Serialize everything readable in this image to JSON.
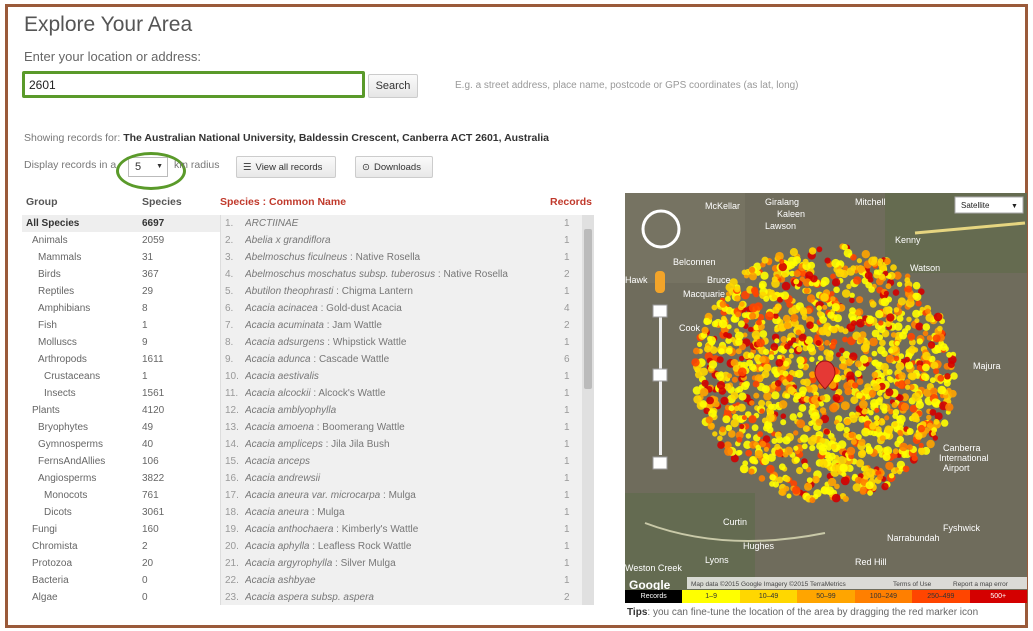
{
  "page": {
    "title": "Explore Your Area",
    "subtitle": "Enter your location or address:",
    "search_value": "2601",
    "search_button": "Search",
    "hint": "E.g. a street address, place name, postcode or GPS coordinates (as lat, long)",
    "showing_prefix": "Showing records for:",
    "showing_location": "The Australian National University, Baldessin Crescent, Canberra ACT 2601, Australia",
    "display_prefix": "Display records in a",
    "radius": "5",
    "radius_suffix": "km radius",
    "view_all": "View all records",
    "downloads": "Downloads"
  },
  "table": {
    "group_header": "Group",
    "species_header": "Species",
    "list_header": "Species : Common Name",
    "records_header": "Records"
  },
  "groups": [
    {
      "name": "All Species",
      "count": "6697",
      "indent": 0,
      "active": true
    },
    {
      "name": "Animals",
      "count": "2059",
      "indent": 1
    },
    {
      "name": "Mammals",
      "count": "31",
      "indent": 2
    },
    {
      "name": "Birds",
      "count": "367",
      "indent": 2
    },
    {
      "name": "Reptiles",
      "count": "29",
      "indent": 2
    },
    {
      "name": "Amphibians",
      "count": "8",
      "indent": 2
    },
    {
      "name": "Fish",
      "count": "1",
      "indent": 2
    },
    {
      "name": "Molluscs",
      "count": "9",
      "indent": 2
    },
    {
      "name": "Arthropods",
      "count": "1611",
      "indent": 2
    },
    {
      "name": "Crustaceans",
      "count": "1",
      "indent": 3
    },
    {
      "name": "Insects",
      "count": "1561",
      "indent": 3
    },
    {
      "name": "Plants",
      "count": "4120",
      "indent": 1
    },
    {
      "name": "Bryophytes",
      "count": "49",
      "indent": 2
    },
    {
      "name": "Gymnosperms",
      "count": "40",
      "indent": 2
    },
    {
      "name": "FernsAndAllies",
      "count": "106",
      "indent": 2
    },
    {
      "name": "Angiosperms",
      "count": "3822",
      "indent": 2
    },
    {
      "name": "Monocots",
      "count": "761",
      "indent": 3
    },
    {
      "name": "Dicots",
      "count": "3061",
      "indent": 3
    },
    {
      "name": "Fungi",
      "count": "160",
      "indent": 1
    },
    {
      "name": "Chromista",
      "count": "2",
      "indent": 1
    },
    {
      "name": "Protozoa",
      "count": "20",
      "indent": 1
    },
    {
      "name": "Bacteria",
      "count": "0",
      "indent": 1
    },
    {
      "name": "Algae",
      "count": "0",
      "indent": 1
    }
  ],
  "species": [
    {
      "n": "1.",
      "sci": "ARCTIINAE",
      "common": "",
      "rec": "1"
    },
    {
      "n": "2.",
      "sci": "Abelia x grandiflora",
      "common": "",
      "rec": "1"
    },
    {
      "n": "3.",
      "sci": "Abelmoschus ficulneus",
      "common": "Native Rosella",
      "rec": "1"
    },
    {
      "n": "4.",
      "sci": "Abelmoschus moschatus subsp. tuberosus",
      "common": "Native Rosella",
      "rec": "2"
    },
    {
      "n": "5.",
      "sci": "Abutilon theophrasti",
      "common": "Chigma Lantern",
      "rec": "1"
    },
    {
      "n": "6.",
      "sci": "Acacia acinacea",
      "common": "Gold-dust Acacia",
      "rec": "4"
    },
    {
      "n": "7.",
      "sci": "Acacia acuminata",
      "common": "Jam Wattle",
      "rec": "2"
    },
    {
      "n": "8.",
      "sci": "Acacia adsurgens",
      "common": "Whipstick Wattle",
      "rec": "1"
    },
    {
      "n": "9.",
      "sci": "Acacia adunca",
      "common": "Cascade Wattle",
      "rec": "6"
    },
    {
      "n": "10.",
      "sci": "Acacia aestivalis",
      "common": "",
      "rec": "1"
    },
    {
      "n": "11.",
      "sci": "Acacia alcockii",
      "common": "Alcock's Wattle",
      "rec": "1"
    },
    {
      "n": "12.",
      "sci": "Acacia amblyophylla",
      "common": "",
      "rec": "1"
    },
    {
      "n": "13.",
      "sci": "Acacia amoena",
      "common": "Boomerang Wattle",
      "rec": "1"
    },
    {
      "n": "14.",
      "sci": "Acacia ampliceps",
      "common": "Jila Jila Bush",
      "rec": "1"
    },
    {
      "n": "15.",
      "sci": "Acacia anceps",
      "common": "",
      "rec": "1"
    },
    {
      "n": "16.",
      "sci": "Acacia andrewsii",
      "common": "",
      "rec": "1"
    },
    {
      "n": "17.",
      "sci": "Acacia aneura var. microcarpa",
      "common": "Mulga",
      "rec": "1"
    },
    {
      "n": "18.",
      "sci": "Acacia aneura",
      "common": "Mulga",
      "rec": "1"
    },
    {
      "n": "19.",
      "sci": "Acacia anthochaera",
      "common": "Kimberly's Wattle",
      "rec": "1"
    },
    {
      "n": "20.",
      "sci": "Acacia aphylla",
      "common": "Leafless Rock Wattle",
      "rec": "1"
    },
    {
      "n": "21.",
      "sci": "Acacia argyrophylla",
      "common": "Silver Mulga",
      "rec": "1"
    },
    {
      "n": "22.",
      "sci": "Acacia ashbyae",
      "common": "",
      "rec": "1"
    },
    {
      "n": "23.",
      "sci": "Acacia aspera subsp. aspera",
      "common": "",
      "rec": "2"
    }
  ],
  "map": {
    "type_select": "Satellite",
    "places": [
      "McKellar",
      "Giralang",
      "Kaleen",
      "Lawson",
      "Mitchell",
      "Kenny",
      "Belconnen",
      "Bruce",
      "Watson",
      "Macquarie",
      "Cook",
      "Hawk",
      "Majura",
      "Canberra International Airport",
      "Curtin",
      "Hughes",
      "Narrabundah",
      "Red Hill",
      "Lyons",
      "Weston Creek",
      "Fyshwick"
    ],
    "attribution": "Map data ©2015 Google Imagery ©2015 TerraMetrics",
    "terms": "Terms of Use",
    "report": "Report a map error",
    "google": "Google"
  },
  "legend": [
    {
      "label": "Records",
      "color": "#000000",
      "text": "#ffffff"
    },
    {
      "label": "1–9",
      "color": "#ffff00",
      "text": "#333333"
    },
    {
      "label": "10–49",
      "color": "#ffd700",
      "text": "#333333"
    },
    {
      "label": "50–99",
      "color": "#ffa500",
      "text": "#333333"
    },
    {
      "label": "100–249",
      "color": "#ff7f00",
      "text": "#333333"
    },
    {
      "label": "250–499",
      "color": "#ff4500",
      "text": "#333333"
    },
    {
      "label": "500+",
      "color": "#d40000",
      "text": "#ffffff"
    }
  ],
  "tips": {
    "bold": "Tips",
    "text": ": you can fine-tune the location of the area by dragging the red marker icon"
  }
}
